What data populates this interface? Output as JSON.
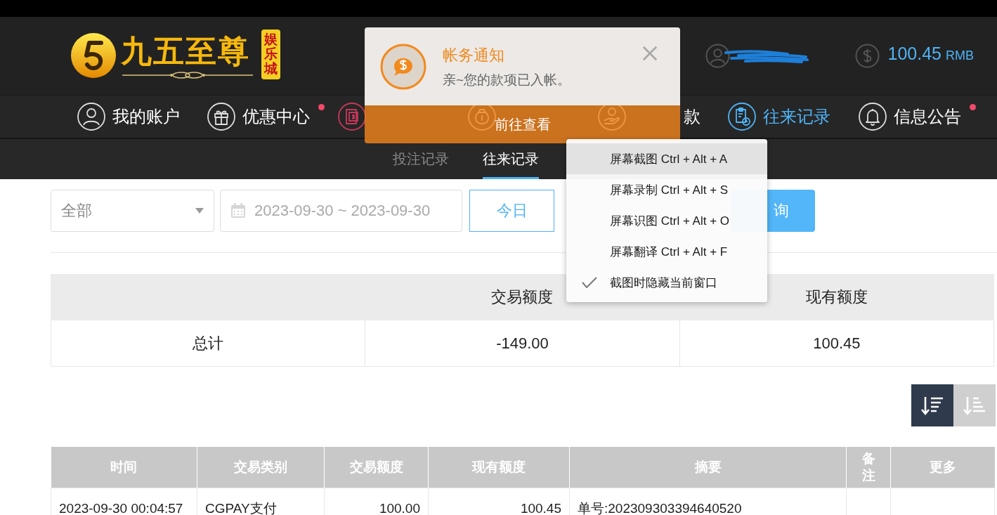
{
  "header": {
    "logo": {
      "name": "九五至尊",
      "tag": "娱乐城"
    },
    "balance": {
      "amount": "100.45",
      "currency": "RMB"
    }
  },
  "nav": [
    {
      "label": "我的账户",
      "selected": false,
      "dot": false
    },
    {
      "label": "优惠中心",
      "selected": false,
      "dot": true
    },
    {
      "selected": false,
      "dot": false
    },
    {
      "selected": false,
      "dot": false
    },
    {
      "label": "款",
      "selected": false,
      "dot": false
    },
    {
      "label": "往来记录",
      "selected": true,
      "dot": false
    },
    {
      "label": "信息公告",
      "selected": false,
      "dot": true
    }
  ],
  "notification": {
    "title": "帐务通知",
    "message": "亲~您的款项已入帐。",
    "action": "前往查看"
  },
  "subtabs": [
    {
      "label": "投注记录",
      "selected": false
    },
    {
      "label": "往来记录",
      "selected": true
    }
  ],
  "filters": {
    "type_select": {
      "value": "全部"
    },
    "date_range": {
      "value": "2023-09-30 ~ 2023-09-30"
    },
    "quick_ranges": [
      {
        "label": "今日",
        "selected": true
      }
    ],
    "search_button": "询"
  },
  "summary": {
    "columns": [
      "交易额度",
      "现有额度"
    ],
    "row": [
      "总计",
      "-149.00",
      "100.45"
    ]
  },
  "sort_buttons": [
    {
      "selected": true
    },
    {
      "selected": false
    }
  ],
  "table": {
    "columns": [
      "时间",
      "交易类别",
      "交易额度",
      "现有额度",
      "摘要",
      "备注",
      "更多"
    ],
    "rows": [
      [
        "2023-09-30 00:04:57",
        "CGPAY支付",
        "100.00",
        "100.45",
        "单号:202309303394640520"
      ]
    ]
  },
  "context_menu": {
    "items": [
      {
        "label": "屏幕截图 Ctrl + Alt + A",
        "selected": true,
        "checked": false
      },
      {
        "label": "屏幕录制 Ctrl + Alt + S",
        "selected": false,
        "checked": false
      },
      {
        "label": "屏幕识图 Ctrl + Alt + O",
        "selected": false,
        "checked": false
      },
      {
        "label": "屏幕翻译 Ctrl + Alt + F",
        "selected": false,
        "checked": false
      },
      {
        "label": "截图时隐藏当前窗口",
        "selected": false,
        "checked": true
      }
    ]
  }
}
